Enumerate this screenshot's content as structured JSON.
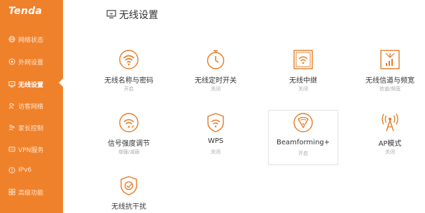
{
  "brand": {
    "logo_text": "Tenda"
  },
  "sidebar": {
    "items": [
      {
        "label": "网络状态",
        "icon": "globe-icon"
      },
      {
        "label": "外网设置",
        "icon": "globe-gear-icon"
      },
      {
        "label": "无线设置",
        "icon": "wifi-monitor-icon",
        "active": true
      },
      {
        "label": "访客网络",
        "icon": "guest-icon"
      },
      {
        "label": "家长控制",
        "icon": "parental-icon"
      },
      {
        "label": "VPN服务",
        "icon": "vpn-icon"
      },
      {
        "label": "IPv6",
        "icon": "ipv6-icon"
      },
      {
        "label": "高级功能",
        "icon": "apps-icon"
      }
    ]
  },
  "header": {
    "title": "无线设置",
    "icon": "wifi-monitor-icon"
  },
  "tiles": [
    {
      "name": "无线名称与密码",
      "status": "开启",
      "icon": "wifi-icon"
    },
    {
      "name": "无线定时开关",
      "status": "关闭",
      "icon": "timer-icon"
    },
    {
      "name": "无线中继",
      "status": "关闭",
      "icon": "repeater-icon"
    },
    {
      "name": "无线信道与频宽",
      "status": "信道/频宽",
      "icon": "signal-bars-icon"
    },
    {
      "name": "信号强度调节",
      "status": "增强/减弱",
      "icon": "signal-strength-icon"
    },
    {
      "name": "WPS",
      "status": "关闭",
      "icon": "wps-shield-icon"
    },
    {
      "name": "Beamforming+",
      "status": "开启",
      "icon": "beamforming-icon"
    },
    {
      "name": "AP模式",
      "status": "关闭",
      "icon": "ap-tower-icon"
    },
    {
      "name": "无线抗干扰",
      "status": "",
      "icon": "anti-interference-icon"
    }
  ],
  "colors": {
    "accent": "#f0812b",
    "icon": "#e67a22",
    "text": "#333333",
    "muted": "#aaaaaa"
  }
}
